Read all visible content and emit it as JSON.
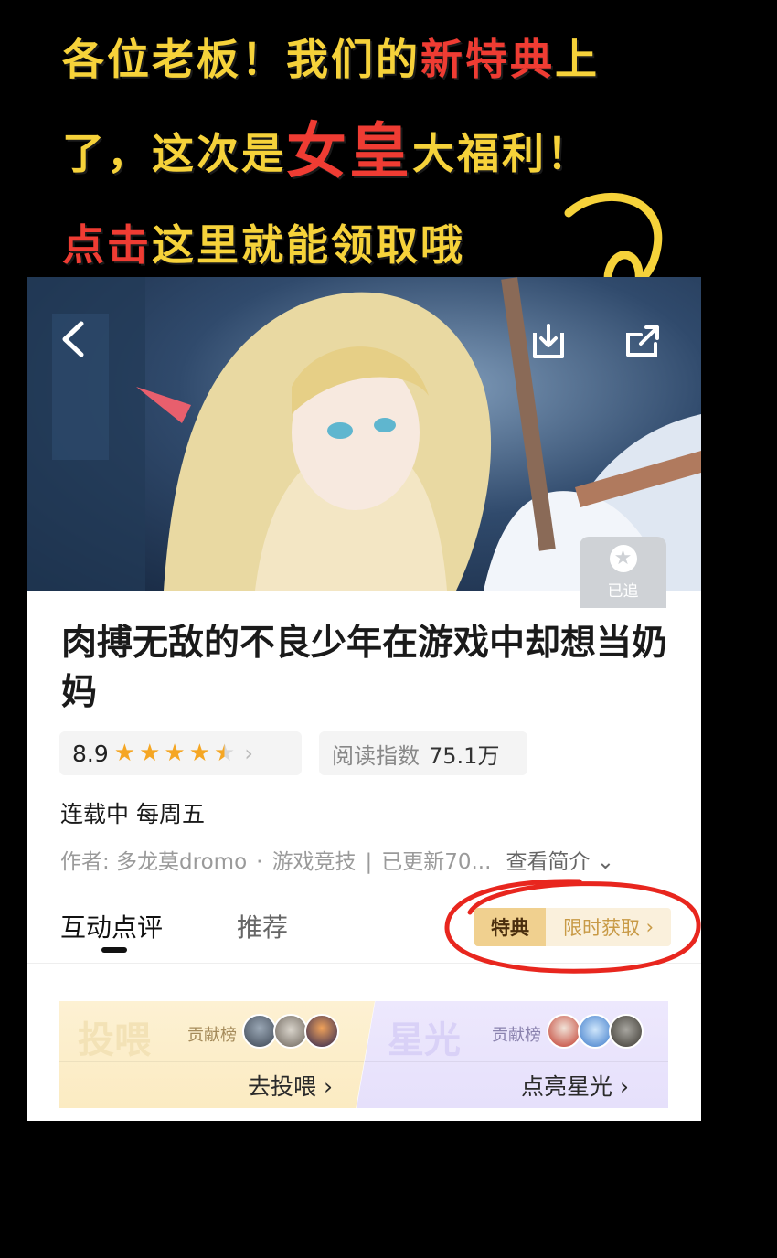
{
  "promo": {
    "line1_a": "各位老板！我们的",
    "line1_b": "新特典",
    "line1_c": "上",
    "line2_a": "了，这次是",
    "line2_b": "女皇",
    "line2_c": "大福利！",
    "line3_a": "点击",
    "line3_b": "这里就能领取哦"
  },
  "comic": {
    "title": "肉搏无敌的不良少年在游戏中却想当奶妈",
    "rating": "8.9",
    "stars": 4.5,
    "read_label": "阅读指数",
    "read_value": "75.1万",
    "status": "连载中 每周五",
    "author": "作者: 多龙莫dromo",
    "genre": "游戏竞技",
    "updated": "已更新70...",
    "synopsis": "查看简介"
  },
  "follow": {
    "label": "已追"
  },
  "tabs": {
    "comments": "互动点评",
    "recommend": "推荐"
  },
  "special": {
    "tag": "特典",
    "action": "限时获取"
  },
  "cards": {
    "feed": {
      "big": "投喂",
      "rank": "贡献榜",
      "action": "去投喂"
    },
    "starlight": {
      "big": "星光",
      "rank": "贡献榜",
      "action": "点亮星光"
    }
  },
  "colors": {
    "promo_yellow": "#f6d23a",
    "promo_red": "#ef3c33",
    "star": "#f5a623"
  }
}
